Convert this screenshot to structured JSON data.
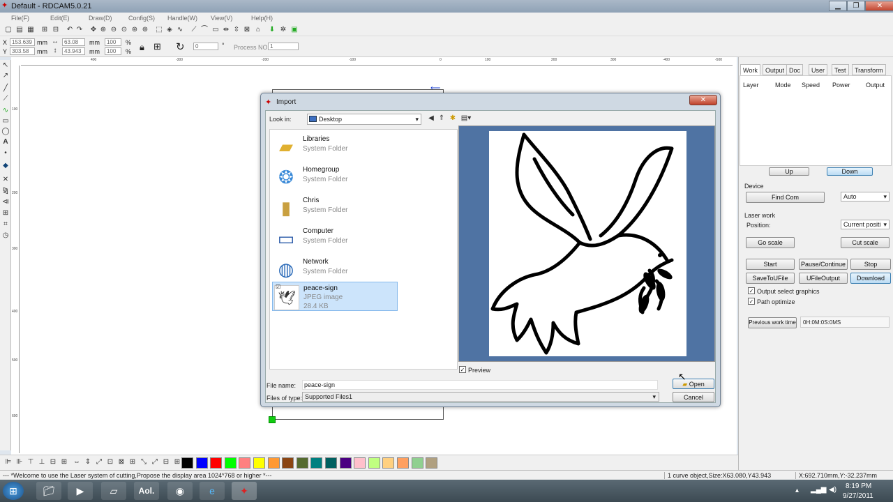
{
  "window": {
    "title": "Default - RDCAM5.0.21"
  },
  "menu": [
    "File(F)",
    "Edit(E)",
    "Draw(D)",
    "Config(S)",
    "Handle(W)",
    "View(V)",
    "Help(H)"
  ],
  "coords": {
    "x_label": "X",
    "y_label": "Y",
    "x": "153.639",
    "y": "303.58",
    "unit": "mm",
    "w": "63.08",
    "h": "43.943",
    "sx": "100",
    "sy": "100",
    "pct": "%",
    "angle": "0",
    "deg": "°",
    "process_label": "Process NO:",
    "process_no": "1"
  },
  "ruler_h": [
    "400",
    "-300",
    "-200",
    "-100",
    "0",
    "100",
    "200",
    "300",
    "-400",
    "-500"
  ],
  "ruler_v": [
    "100",
    "200",
    "300",
    "400",
    "500",
    "600"
  ],
  "panel": {
    "tabs": [
      "Work",
      "Output",
      "Doc",
      "User",
      "Test",
      "Transform"
    ],
    "layer_headers": [
      "Layer",
      "Mode",
      "Speed",
      "Power",
      "Output"
    ],
    "up": "Up",
    "down": "Down",
    "device_label": "Device",
    "find_com": "Find Com",
    "auto": "Auto",
    "laser_work": "Laser work",
    "position_label": "Position:",
    "position_value": "Current positi",
    "go_scale": "Go scale",
    "cut_scale": "Cut scale",
    "start": "Start",
    "pause": "Pause/Continue",
    "stop": "Stop",
    "save_to_file": "SaveToUFile",
    "ufile_output": "UFileOutput",
    "download": "Download",
    "output_select": "Output select graphics",
    "path_optimize": "Path optimize",
    "prev_work_time": "Previous work time",
    "work_time": "0H:0M:0S:0MS"
  },
  "palette_colors": [
    "#000000",
    "#0000ff",
    "#ff0000",
    "#00ff00",
    "#ff8080",
    "#ffff00",
    "#ff9933",
    "#8b4513",
    "#556b2f",
    "#008080",
    "#006060",
    "#4b0082",
    "#ffc0cb",
    "#c0ff80",
    "#ffd080",
    "#ffa060",
    "#90d090",
    "#b0a080"
  ],
  "status": {
    "left": "--- *Welcome to use the Laser system of cutting,Propose the display area 1024*768 or higher *---",
    "mid": "1 curve object,Size:X63.080,Y43.943",
    "right": "X:692.710mm,Y:-32.237mm"
  },
  "taskbar": {
    "time": "8:19 PM",
    "date": "9/27/2011"
  },
  "dialog": {
    "title": "Import",
    "look_in_label": "Look in:",
    "look_in_value": "Desktop",
    "items": [
      {
        "name": "Libraries",
        "type": "System Folder",
        "icon": "folder-icon"
      },
      {
        "name": "Homegroup",
        "type": "System Folder",
        "icon": "homegroup-icon"
      },
      {
        "name": "Chris",
        "type": "System Folder",
        "icon": "user-folder-icon"
      },
      {
        "name": "Computer",
        "type": "System Folder",
        "icon": "computer-icon"
      },
      {
        "name": "Network",
        "type": "System Folder",
        "icon": "network-icon"
      },
      {
        "name": "peace-sign",
        "type": "JPEG image",
        "size": "28.4 KB",
        "icon": "image-file-icon"
      }
    ],
    "preview_label": "Preview",
    "file_name_label": "File name:",
    "file_name": "peace-sign",
    "file_type_label": "Files of type:",
    "file_type": "Supported Files1",
    "open": "Open",
    "cancel": "Cancel"
  }
}
